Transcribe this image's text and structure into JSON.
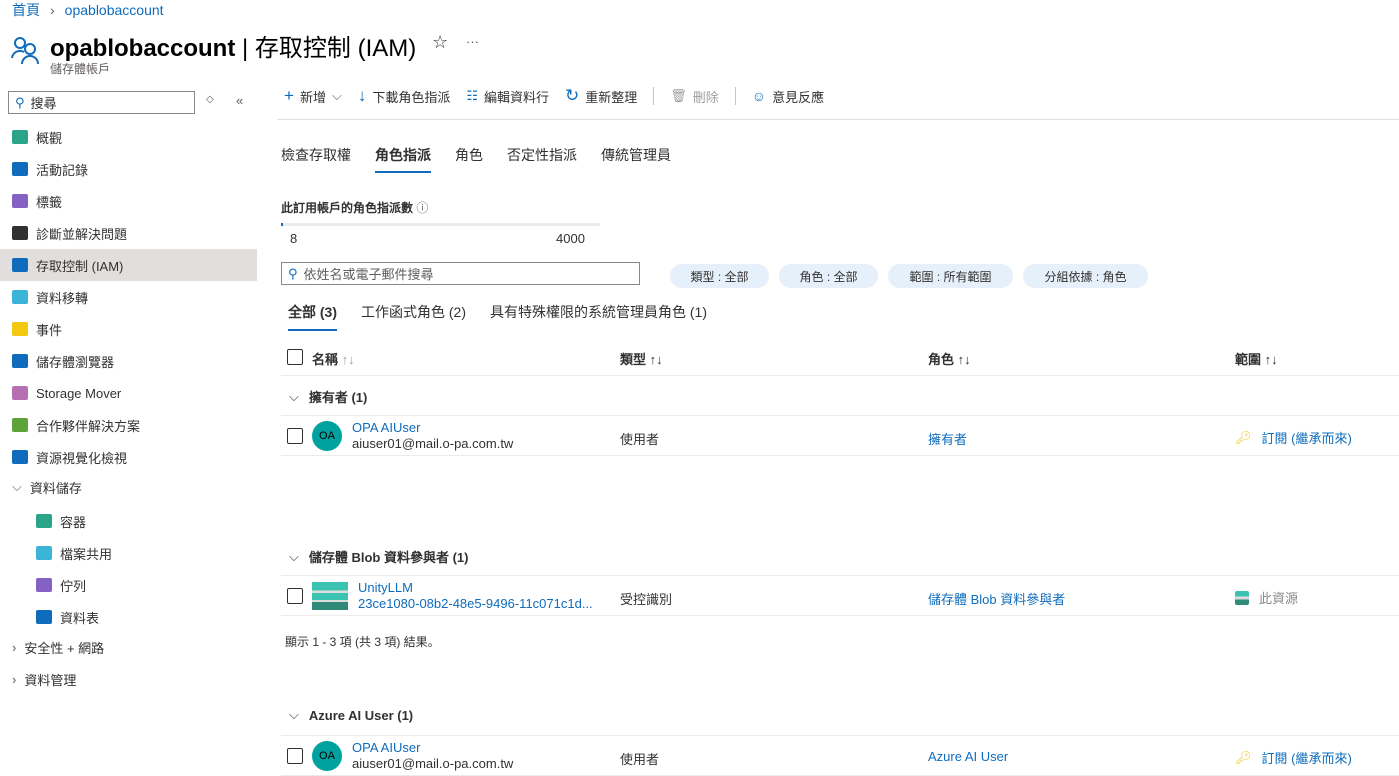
{
  "breadcrumb": {
    "home": "首頁",
    "current": "opablobaccount"
  },
  "header": {
    "resource": "opablobaccount",
    "page": "| 存取控制 (IAM)",
    "subtitle": "儲存體帳戶",
    "more": "···",
    "star": "☆"
  },
  "sidebar": {
    "search_placeholder": "搜尋",
    "items": [
      {
        "label": "概觀",
        "color": "#2aa58a"
      },
      {
        "label": "活動記錄",
        "color": "#0f6cbd"
      },
      {
        "label": "標籤",
        "color": "#8661c5"
      },
      {
        "label": "診斷並解決問題",
        "color": "#323130"
      },
      {
        "label": "存取控制 (IAM)",
        "color": "#0f6cbd"
      },
      {
        "label": "資料移轉",
        "color": "#3bb4d8"
      },
      {
        "label": "事件",
        "color": "#f2c811"
      },
      {
        "label": "儲存體瀏覽器",
        "color": "#0f6cbd"
      },
      {
        "label": "Storage Mover",
        "color": "#b66fb1"
      },
      {
        "label": "合作夥伴解決方案",
        "color": "#5ea33a"
      },
      {
        "label": "資源視覺化檢視",
        "color": "#0f6cbd"
      }
    ],
    "group_data": "資料儲存",
    "sub_items": [
      {
        "label": "容器",
        "color": "#2aa58a"
      },
      {
        "label": "檔案共用",
        "color": "#3bb4d8"
      },
      {
        "label": "佇列",
        "color": "#8661c5"
      },
      {
        "label": "資料表",
        "color": "#0f6cbd"
      }
    ],
    "group_security": "安全性 + 網路",
    "group_mgmt": "資料管理"
  },
  "toolbar": {
    "add": "新增",
    "download": "下載角色指派",
    "edit_columns": "編輯資料行",
    "refresh": "重新整理",
    "delete": "刪除",
    "feedback": "意見反應"
  },
  "tabs": [
    "檢查存取權",
    "角色指派",
    "角色",
    "否定性指派",
    "傳統管理員"
  ],
  "quota": {
    "label": "此訂用帳戶的角色指派數",
    "used": "8",
    "max": "4000",
    "fraction": 0.002
  },
  "filter": {
    "search_placeholder": "依姓名或電子郵件搜尋",
    "pills": [
      "類型 : 全部",
      "角色 : 全部",
      "範圍 : 所有範圍",
      "分組依據 : 角色"
    ]
  },
  "subtabs": [
    "全部 (3)",
    "工作函式角色 (2)",
    "具有特殊權限的系統管理員角色 (1)"
  ],
  "table": {
    "headers": [
      "名稱",
      "類型",
      "角色",
      "範圍"
    ],
    "groups": [
      {
        "title": "擁有者 (1)",
        "row": {
          "avatar": "OA",
          "name": "OPA AIUser",
          "sub": "aiuser01@mail.o-pa.com.tw",
          "type": "使用者",
          "role": "擁有者",
          "scope": "訂閱 (繼承而來)",
          "scope_icon": "key"
        }
      },
      {
        "title": "儲存體 Blob 資料參與者 (1)",
        "row": {
          "avatar": "",
          "name": "UnityLLM",
          "sub": "23ce1080-08b2-48e5-9496-11c071c1d...",
          "type": "受控識別",
          "role": "儲存體 Blob 資料參與者",
          "scope": "此資源",
          "scope_icon": "storage"
        }
      },
      {
        "title": "Azure AI User (1)",
        "row": {
          "avatar": "OA",
          "name": "OPA AIUser",
          "sub": "aiuser01@mail.o-pa.com.tw",
          "type": "使用者",
          "role": "Azure AI User",
          "scope": "訂閱 (繼承而來)",
          "scope_icon": "key"
        }
      }
    ]
  },
  "footer": "顯示 1 - 3 項 (共 3 項) 結果。"
}
